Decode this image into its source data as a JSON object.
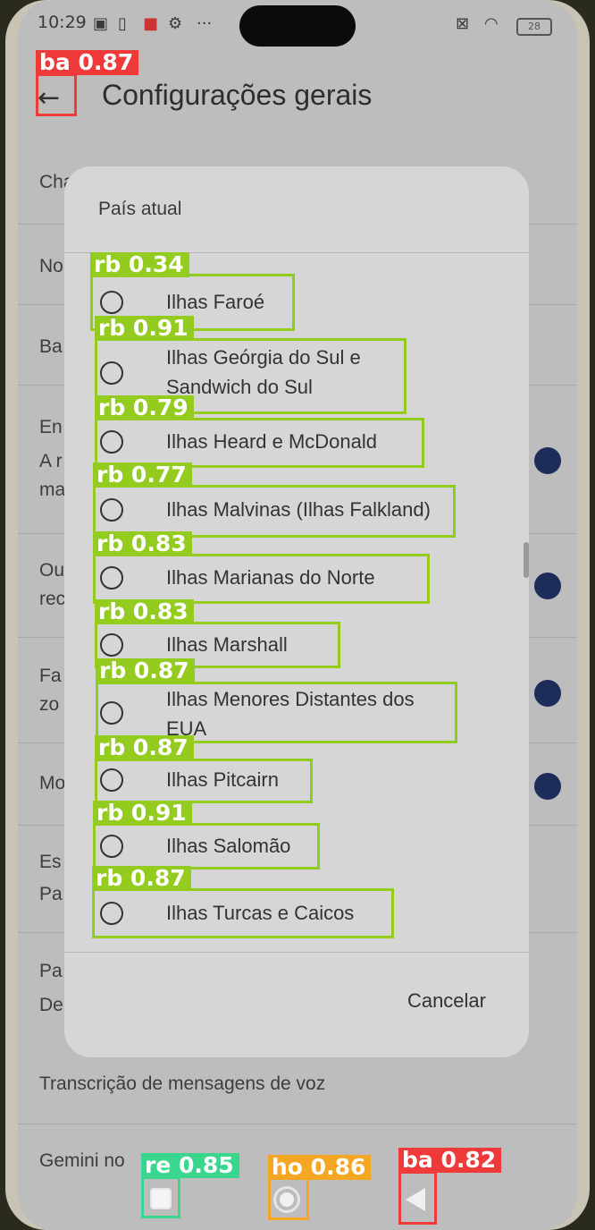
{
  "status_bar": {
    "time": "10:29",
    "icons": [
      "nfc-icon",
      "sim-icon",
      "mail-app-icon",
      "gear-icon",
      "more-dots-icon",
      "screen-icon",
      "wifi-icon",
      "battery-icon"
    ],
    "battery": "28"
  },
  "app_bar": {
    "title": "Configurações gerais",
    "back_icon": "arrow-left-icon"
  },
  "background_rows": [
    "Cha",
    "No",
    "Ba",
    "En",
    "A r",
    "ma",
    "Ou",
    "rec",
    "Fa",
    "zo",
    "Mo",
    "Es",
    "Pa",
    "Pa",
    "De",
    "Transcrição de mensagens de voz",
    "Gemini no"
  ],
  "dialog": {
    "title": "País atual",
    "options": [
      {
        "line1": "Ilhas Faroé",
        "line2": ""
      },
      {
        "line1": "Ilhas Geórgia do Sul e",
        "line2": "Sandwich do Sul"
      },
      {
        "line1": "Ilhas Heard e McDonald",
        "line2": ""
      },
      {
        "line1": "Ilhas Malvinas (Ilhas Falkland)",
        "line2": ""
      },
      {
        "line1": "Ilhas Marianas do Norte",
        "line2": ""
      },
      {
        "line1": "Ilhas Marshall",
        "line2": ""
      },
      {
        "line1": "Ilhas Menores Distantes dos",
        "line2": "EUA"
      },
      {
        "line1": "Ilhas Pitcairn",
        "line2": ""
      },
      {
        "line1": "Ilhas Salomão",
        "line2": ""
      },
      {
        "line1": "Ilhas Turcas e Caicos",
        "line2": ""
      }
    ],
    "cancel_label": "Cancelar"
  },
  "nav_bar": {
    "icons": [
      "recent-apps-icon",
      "home-icon",
      "back-triangle-icon"
    ]
  },
  "detections": [
    {
      "label": "ba 0.87",
      "color": "#f03a3a"
    },
    {
      "label": "rb 0.34",
      "color": "#93cc1f"
    },
    {
      "label": "rb 0.91",
      "color": "#93cc1f"
    },
    {
      "label": "rb 0.79",
      "color": "#93cc1f"
    },
    {
      "label": "rb 0.77",
      "color": "#93cc1f"
    },
    {
      "label": "rb 0.83",
      "color": "#93cc1f"
    },
    {
      "label": "rb 0.83",
      "color": "#93cc1f"
    },
    {
      "label": "rb 0.87",
      "color": "#93cc1f"
    },
    {
      "label": "rb 0.87",
      "color": "#93cc1f"
    },
    {
      "label": "rb 0.91",
      "color": "#93cc1f"
    },
    {
      "label": "rb 0.87",
      "color": "#93cc1f"
    },
    {
      "label": "re 0.85",
      "color": "#3ad68e"
    },
    {
      "label": "ho 0.86",
      "color": "#f5a623"
    },
    {
      "label": "ba 0.82",
      "color": "#f03a3a"
    }
  ]
}
